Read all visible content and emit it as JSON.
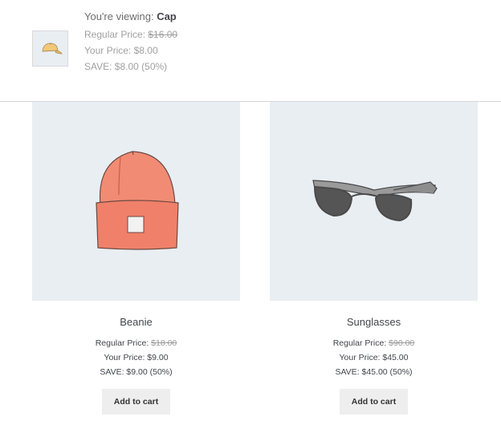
{
  "viewing": {
    "label": "You're viewing:",
    "product": "Cap",
    "regular_label": "Regular Price:",
    "regular_value": "$16.00",
    "your_line": "Your Price: $8.00",
    "save_line": "SAVE: $8.00 (50%)",
    "thumb_icon": "cap-icon"
  },
  "products": [
    {
      "name": "Beanie",
      "image_icon": "beanie-icon",
      "regular_label": "Regular Price:",
      "regular_value": "$18.00",
      "your_line": "Your Price: $9.00",
      "save_line": "SAVE: $9.00 (50%)",
      "button": "Add to cart"
    },
    {
      "name": "Sunglasses",
      "image_icon": "sunglasses-icon",
      "regular_label": "Regular Price:",
      "regular_value": "$90.00",
      "your_line": "Your Price: $45.00",
      "save_line": "SAVE: $45.00 (50%)",
      "button": "Add to cart"
    }
  ]
}
